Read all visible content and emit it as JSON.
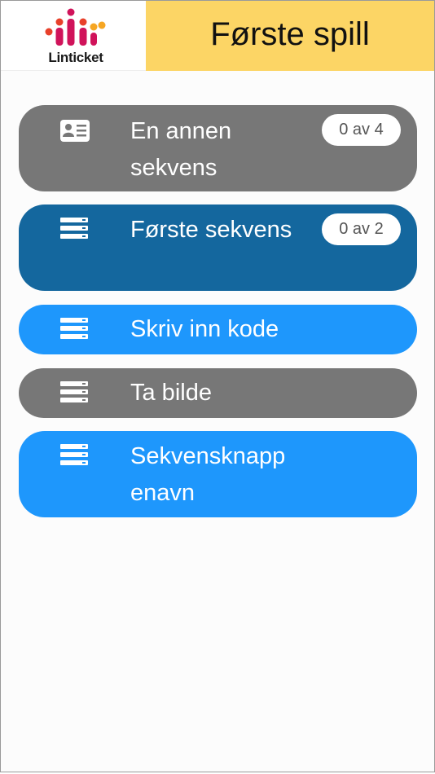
{
  "app": {
    "logo_text": "Linticket",
    "title": "Første spill"
  },
  "colors": {
    "header_bg": "#fcd565",
    "gray": "#777777",
    "dark_blue": "#14679e",
    "bright_blue": "#1e97fc"
  },
  "buttons": [
    {
      "label": "En annen sekvens",
      "badge": "0 av 4",
      "icon": "id-card-icon",
      "color": "#777777"
    },
    {
      "label": "Første sekvens",
      "badge": "0 av 2",
      "icon": "list-icon",
      "color": "#14679e"
    },
    {
      "label": "Skriv inn kode",
      "icon": "list-icon",
      "color": "#1e97fc"
    },
    {
      "label": "Ta bilde",
      "icon": "list-icon",
      "color": "#777777"
    },
    {
      "label": "Sekvensknapp enavn",
      "icon": "list-icon",
      "color": "#1e97fc"
    }
  ]
}
